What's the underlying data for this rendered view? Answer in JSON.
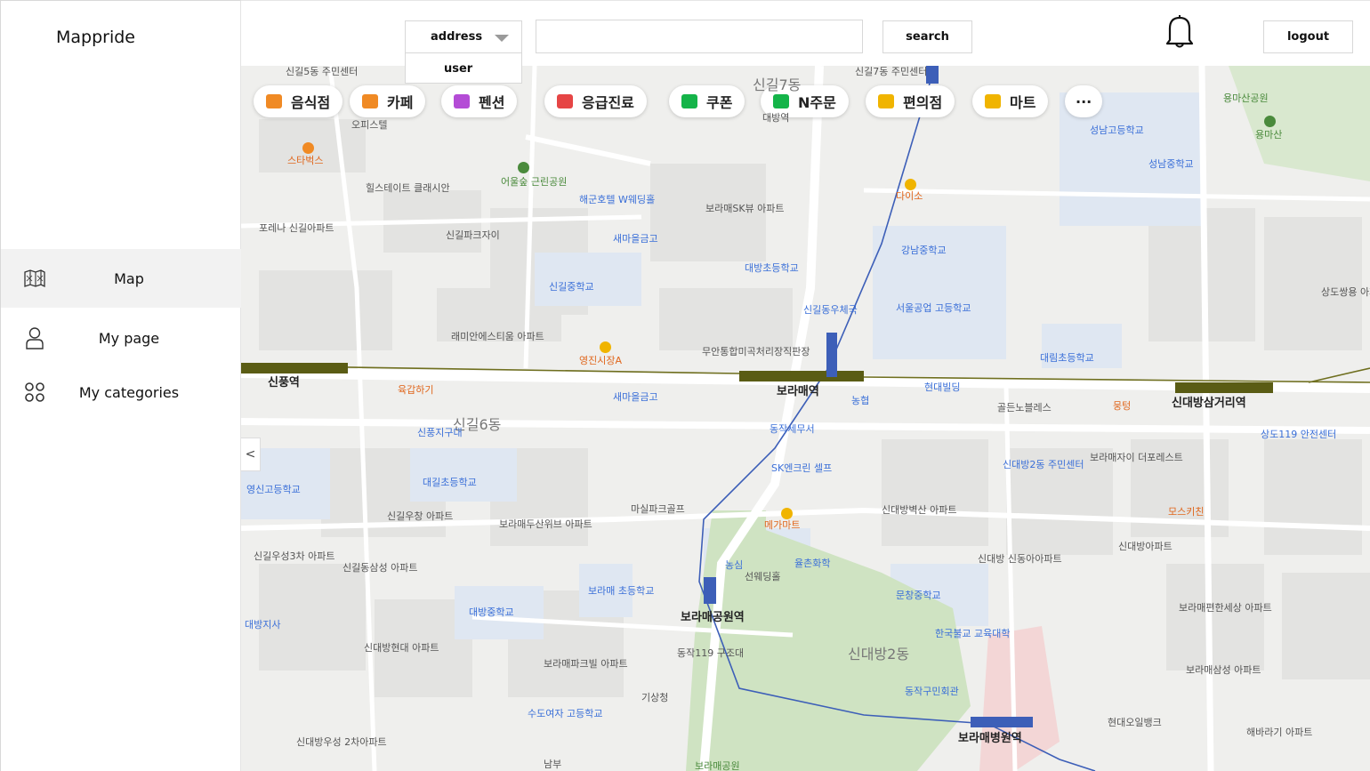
{
  "app": {
    "logo": "Mappride"
  },
  "sidebar": {
    "items": [
      {
        "label": "Map",
        "icon": "map-icon",
        "active": true
      },
      {
        "label": "My page",
        "icon": "user-icon",
        "active": false
      },
      {
        "label": "My categories",
        "icon": "categories-icon",
        "active": false
      }
    ]
  },
  "topbar": {
    "select_value": "address",
    "dropdown_option": "user",
    "search_placeholder": "",
    "search_label": "search",
    "logout_label": "logout"
  },
  "map": {
    "collapse_glyph": "<",
    "chips": [
      {
        "label": "음식점",
        "icon": "fork-knife-icon",
        "color": "#f08a24"
      },
      {
        "label": "카페",
        "icon": "cup-icon",
        "color": "#f08a24"
      },
      {
        "label": "펜션",
        "icon": "bed-icon",
        "color": "#b44cd6"
      },
      {
        "label": "응급진료",
        "icon": "medical-cross-icon",
        "color": "#e64545"
      },
      {
        "label": "쿠폰",
        "icon": "coupon-icon",
        "color": "#14b449"
      },
      {
        "label": "N주문",
        "icon": "order-icon",
        "color": "#14b449"
      },
      {
        "label": "편의점",
        "icon": "store-icon",
        "color": "#f0b400"
      },
      {
        "label": "마트",
        "icon": "cart-icon",
        "color": "#f0b400"
      },
      {
        "label": "···",
        "icon": "more-icon",
        "color": "#333333"
      }
    ],
    "districts": [
      "신길7동",
      "신길6동",
      "신대방2동"
    ],
    "stations": [
      "신풍역",
      "보라매역",
      "신대방삼거리역",
      "보라매공원역",
      "보라매병원역"
    ],
    "poi_blue": [
      "성남고등학교",
      "성남중학교",
      "해군호텔 W웨딩홀",
      "대방초등학교",
      "신길중학교",
      "강남중학교",
      "서울공업 고등학교",
      "신길동우체국",
      "대림초등학교",
      "새마을금고",
      "신풍지구대",
      "대길초등학교",
      "영신고등학교",
      "SK엔크린 셀프",
      "동작세무서",
      "보라매 초등학교",
      "대방중학교",
      "신대방2동 주민센터",
      "대방지사",
      "동작구민회관",
      "문창중학교",
      "한국불교 교육대학",
      "수도여자 고등학교",
      "농심",
      "율촌화학",
      "상도119 안전센터",
      "새마을금고",
      "현대빌딩",
      "무안통합미곡처리장직판장"
    ],
    "poi_orange": [
      "스타벅스",
      "다이소",
      "영진시장A",
      "육갑하기",
      "메가마트",
      "모스키친",
      "뭉텅"
    ],
    "poi_green": [
      "어울숲 근린공원",
      "용마산공원",
      "용마산"
    ],
    "poi_gray": [
      "힐스테이트 클래시안",
      "포레나 신길아파트",
      "신길파크자이",
      "보라매SK뷰 아파트",
      "래미안에스티움 아파트",
      "골든노블레스",
      "신대방벽산 아파트",
      "보라매자이 더포레스트",
      "신대방아파트",
      "신길우창 아파트",
      "보라매두산위브 아파트",
      "마실파크골프",
      "신길우성3차 아파트",
      "신길동삼성 아파트",
      "신대방 신동아아파트",
      "보라매편한세상 아파트",
      "신대방현대 아파트",
      "보라매파크빌 아파트",
      "동작119 구조대",
      "기상청",
      "보라매삼성 아파트",
      "현대오일뱅크",
      "해바라기 아파트",
      "신대방우성 2차아파트",
      "신길5동 주민센터",
      "신길7동 주민센터",
      "오피스텔",
      "선웨딩홀",
      "남부",
      "보라매공원",
      "농협",
      "대방역",
      "상도쌍용 아파"
    ]
  }
}
